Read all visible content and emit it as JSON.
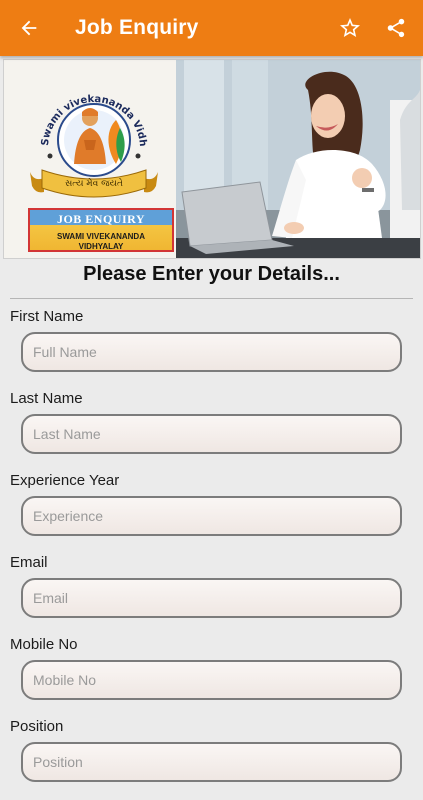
{
  "appbar": {
    "title": "Job Enquiry",
    "back_icon": "arrow-left-icon",
    "favorite_icon": "star-outline-icon",
    "share_icon": "share-icon",
    "bg_color": "#ee7d13"
  },
  "banner": {
    "logo_arc_text": "Swami vivekananda Vidhyalay",
    "motto": "સત્ય મેવ જયતે",
    "box_title": "JOB ENQUIRY",
    "box_line1": "SWAMI VIVEKANANDA",
    "box_line2": "VIDHYALAY"
  },
  "form": {
    "heading": "Please Enter your Details...",
    "fields": [
      {
        "label": "First Name",
        "placeholder": "Full Name",
        "value": ""
      },
      {
        "label": "Last Name",
        "placeholder": "Last Name",
        "value": ""
      },
      {
        "label": "Experience Year",
        "placeholder": "Experience",
        "value": ""
      },
      {
        "label": "Email",
        "placeholder": "Email",
        "value": ""
      },
      {
        "label": "Mobile No",
        "placeholder": "Mobile No",
        "value": ""
      },
      {
        "label": "Position",
        "placeholder": "Position",
        "value": ""
      }
    ]
  }
}
